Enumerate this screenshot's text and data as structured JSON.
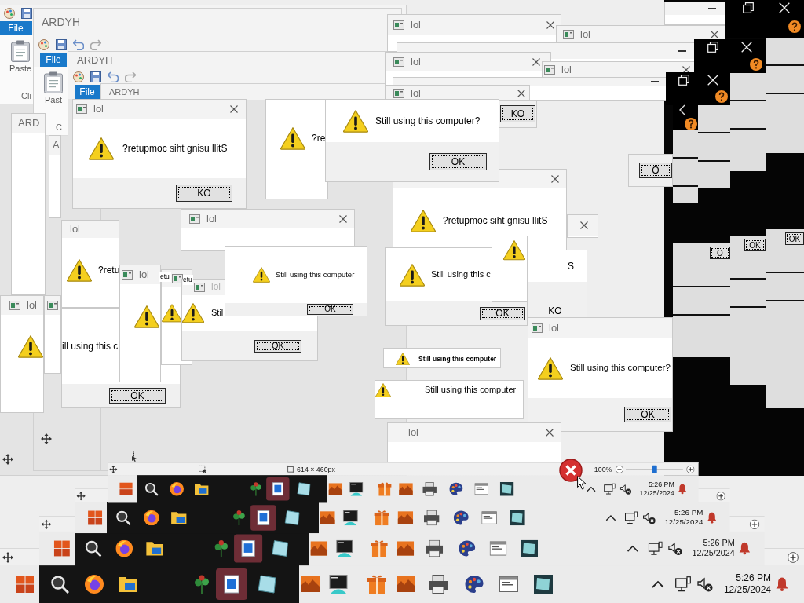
{
  "windows": [
    {
      "kind": "paint",
      "toolbar": true,
      "file_tab": "File",
      "paste_label": "Paste",
      "group_label": "Cli"
    },
    {
      "kind": "paint",
      "title": "ARDYH",
      "toolbar": true,
      "file_tab": "File",
      "paste_label": "Past",
      "group_label": "C"
    },
    {
      "kind": "paint",
      "title": "ARDYH",
      "toolbar": true,
      "file_tab": "File"
    },
    {
      "kind": "paint",
      "title": "ARDYH"
    },
    {
      "kind": "dialog",
      "title": "ARD"
    },
    {
      "kind": "dialog",
      "title": "A"
    },
    {
      "kind": "dialog",
      "minimize_button": true
    },
    {
      "kind": "dialog",
      "title": "lol",
      "app_icon": true,
      "close_button": true
    },
    {
      "kind": "dialog",
      "title": "lol",
      "app_icon": true,
      "close_button": true
    },
    {
      "kind": "dialog",
      "minimize_button": true
    },
    {
      "kind": "dialog",
      "title": "lol",
      "app_icon": true,
      "close_button": true
    },
    {
      "kind": "dialog",
      "title": "lol",
      "app_icon": true,
      "close_button": true
    },
    {
      "kind": "dialog",
      "minimize_button": true
    },
    {
      "kind": "dialog",
      "title": "lol",
      "app_icon": true,
      "close_button": true
    },
    {
      "kind": "dialog",
      "button": "KO"
    },
    {
      "kind": "dialog",
      "button": "O"
    },
    {
      "kind": "dialog",
      "title": "lol",
      "app_icon": true,
      "close_button": true,
      "warning_icon": true,
      "message": "?retupmoc siht gnisu llitS",
      "button": "KO"
    },
    {
      "kind": "dialog",
      "warning_icon": true,
      "message": "?re"
    },
    {
      "kind": "dialog",
      "close_button": true,
      "warning_icon": true,
      "message": "?retupmoc siht gnisu llitS"
    },
    {
      "kind": "dialog",
      "warning_icon": true,
      "message": "Still using this computer?",
      "button": "OK"
    },
    {
      "kind": "dialog",
      "close_button": true
    },
    {
      "kind": "dialog",
      "title": "lol",
      "app_icon": true,
      "close_button": true
    },
    {
      "kind": "dialog",
      "title": "lol",
      "warning_icon": true,
      "message": "?retu"
    },
    {
      "kind": "dialog",
      "message": "ill using this c",
      "button": "OK"
    },
    {
      "kind": "dialog",
      "title": "lol",
      "app_icon": true,
      "warning_icon": true
    },
    {
      "kind": "dialog",
      "app_icon": true
    },
    {
      "kind": "dialog",
      "title": "lol",
      "app_icon": true,
      "warning_icon": true
    },
    {
      "kind": "dialog",
      "app_icon": true,
      "warning_icon": true
    },
    {
      "kind": "dialog",
      "title": "lol",
      "app_icon": true,
      "warning_icon": true,
      "message": "Stil",
      "button": "OK"
    },
    {
      "kind": "dialog",
      "message": "etu"
    },
    {
      "kind": "dialog",
      "message": "etu"
    },
    {
      "kind": "dialog",
      "warning_icon": true,
      "message": "Still using this computer",
      "button": "OK"
    },
    {
      "kind": "dialog",
      "warning_icon": true,
      "message": "Still using this c",
      "button": "OK"
    },
    {
      "kind": "dialog",
      "warning_icon": true
    },
    {
      "kind": "dialog",
      "message": "S",
      "button": "KO"
    },
    {
      "kind": "dialog",
      "title": "lol",
      "app_icon": true,
      "warning_icon": true,
      "message": "Still using this computer?",
      "button": "OK"
    },
    {
      "kind": "dialog",
      "warning_icon": true,
      "message": "Still using this computer"
    },
    {
      "kind": "dialog",
      "warning_icon": true,
      "message": "Still using this computer"
    },
    {
      "kind": "dialog",
      "title": "lol",
      "close_button": true
    },
    {
      "kind": "dark",
      "restore_button": true,
      "close_button": true,
      "help_button": true
    },
    {
      "kind": "dark",
      "restore_button": true,
      "close_button": true,
      "help_button": true
    },
    {
      "kind": "dark",
      "restore_button": true,
      "close_button": true,
      "help_button": true
    },
    {
      "kind": "dark",
      "back_button": true,
      "help_button": true
    },
    {
      "kind": "panel"
    },
    {
      "kind": "panel"
    },
    {
      "kind": "panel"
    },
    {
      "kind": "panel"
    },
    {
      "kind": "panel",
      "button": "OK"
    },
    {
      "kind": "panel",
      "button": "OK"
    },
    {
      "kind": "panel",
      "button": "O"
    }
  ],
  "screens": [
    {
      "taskbar": {
        "apps": [
          {
            "kind": "start",
            "selected": false
          },
          {
            "kind": "search",
            "selected": false
          },
          {
            "kind": "browser",
            "selected": false
          },
          {
            "kind": "folder",
            "selected": false
          },
          {
            "kind": "plant",
            "selected": false
          },
          {
            "kind": "paint",
            "selected": true
          },
          {
            "kind": "glass",
            "selected": false
          },
          {
            "kind": "landscape",
            "selected": false
          },
          {
            "kind": "terminal",
            "selected": false
          },
          {
            "kind": "gift",
            "selected": false
          },
          {
            "kind": "landscape",
            "selected": false
          },
          {
            "kind": "printer",
            "selected": false
          },
          {
            "kind": "palette",
            "selected": false
          },
          {
            "kind": "window",
            "selected": false
          },
          {
            "kind": "tile",
            "selected": false
          }
        ],
        "time": "5:26 PM",
        "date": "12/25/2024"
      }
    },
    {
      "taskbar": {
        "apps": [
          {
            "kind": "start",
            "selected": false
          },
          {
            "kind": "search",
            "selected": false
          },
          {
            "kind": "browser",
            "selected": false
          },
          {
            "kind": "folder",
            "selected": false
          },
          {
            "kind": "plant",
            "selected": false
          },
          {
            "kind": "paint",
            "selected": true
          },
          {
            "kind": "glass",
            "selected": false
          },
          {
            "kind": "landscape",
            "selected": false
          },
          {
            "kind": "terminal",
            "selected": false
          },
          {
            "kind": "gift",
            "selected": false
          },
          {
            "kind": "landscape",
            "selected": false
          },
          {
            "kind": "printer",
            "selected": false
          },
          {
            "kind": "palette",
            "selected": false
          },
          {
            "kind": "window",
            "selected": false
          },
          {
            "kind": "tile",
            "selected": false
          }
        ],
        "time": "5:26 PM",
        "date": "12/25/2024"
      }
    },
    {
      "taskbar": {
        "apps": [
          {
            "kind": "start",
            "selected": false
          },
          {
            "kind": "search",
            "selected": false
          },
          {
            "kind": "browser",
            "selected": false
          },
          {
            "kind": "folder",
            "selected": false
          },
          {
            "kind": "plant",
            "selected": false
          },
          {
            "kind": "paint",
            "selected": true
          },
          {
            "kind": "glass",
            "selected": false
          },
          {
            "kind": "landscape",
            "selected": false
          },
          {
            "kind": "terminal",
            "selected": false
          },
          {
            "kind": "gift",
            "selected": false
          },
          {
            "kind": "landscape",
            "selected": false
          },
          {
            "kind": "printer",
            "selected": false
          },
          {
            "kind": "palette",
            "selected": false
          },
          {
            "kind": "window",
            "selected": false
          },
          {
            "kind": "tile",
            "selected": false
          }
        ],
        "time": "5:26 PM",
        "date": "12/25/2024"
      }
    },
    {
      "status_bar": {
        "canvas_size": "614 × 460px",
        "zoom": "100%",
        "zoom_slider": {
          "level": 0.5
        }
      },
      "taskbar": {
        "apps": [
          {
            "kind": "start",
            "selected": false
          },
          {
            "kind": "search",
            "selected": false
          },
          {
            "kind": "browser",
            "selected": false
          },
          {
            "kind": "folder",
            "selected": false
          },
          {
            "kind": "plant",
            "selected": false
          },
          {
            "kind": "paint",
            "selected": true
          },
          {
            "kind": "glass",
            "selected": false
          },
          {
            "kind": "landscape",
            "selected": false
          },
          {
            "kind": "terminal",
            "selected": false
          },
          {
            "kind": "gift",
            "selected": false
          },
          {
            "kind": "landscape",
            "selected": false
          },
          {
            "kind": "printer",
            "selected": false
          },
          {
            "kind": "palette",
            "selected": false
          },
          {
            "kind": "window",
            "selected": false
          },
          {
            "kind": "tile",
            "selected": false
          }
        ],
        "time": "5:26 PM",
        "date": "12/25/2024"
      }
    }
  ]
}
